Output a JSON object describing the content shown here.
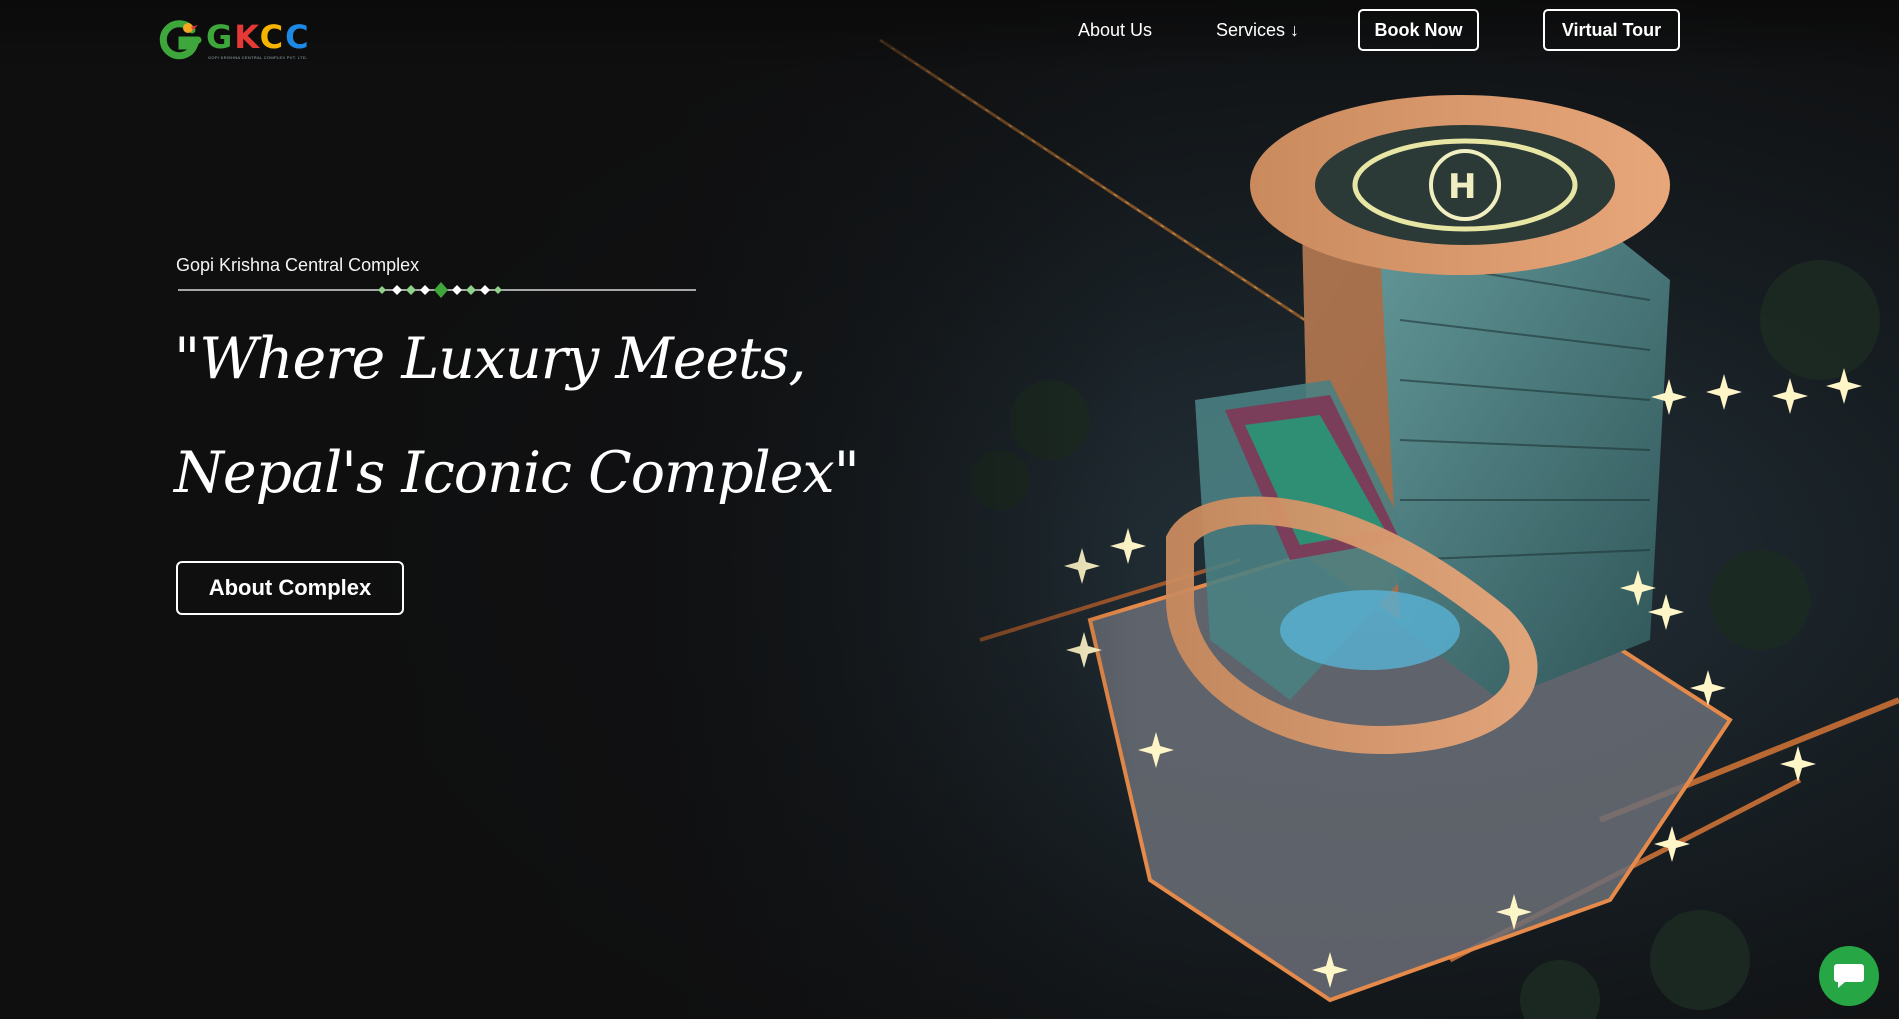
{
  "nav": {
    "logo_text": [
      "G",
      "K",
      "C",
      "C"
    ],
    "logo_subtitle": "GOPI KRISHNA CENTRAL COMPLEX PVT. LTD.",
    "about_label": "About Us",
    "services_label": "Services ↓",
    "book_label": "Book Now",
    "tour_label": "Virtual Tour"
  },
  "hero": {
    "subtitle": "Gopi Krishna Central Complex",
    "headline_line1": "\"Where Luxury Meets,",
    "headline_line2": "Nepal's Iconic Complex\"",
    "cta_label": "About Complex"
  },
  "icons": {
    "logo": "gkcc-logo-icon",
    "chat": "chat-bubble-icon",
    "divider": "diamond-divider"
  },
  "colors": {
    "background": "#0f0f10",
    "accent_green": "#26a645",
    "logo_green": "#3ea73b",
    "logo_red": "#e53935",
    "logo_yellow": "#f5b400",
    "logo_blue": "#1e88e5"
  }
}
